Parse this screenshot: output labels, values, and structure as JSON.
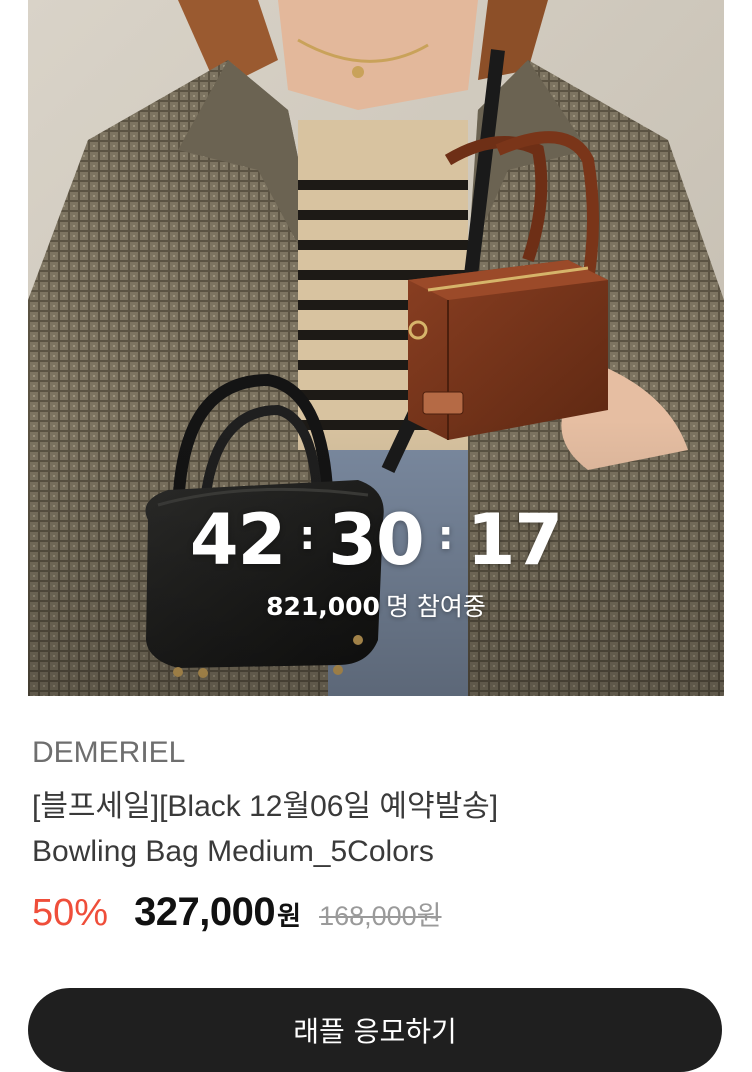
{
  "hero": {
    "countdown": {
      "hours": "42",
      "minutes": "30",
      "seconds": "17",
      "separator": ":"
    },
    "participants_count": "821,000",
    "participants_suffix": "명 참여중"
  },
  "product": {
    "brand": "DEMERIEL",
    "title_line1": "[블프세일][Black 12월06일 예약발송]",
    "title_line2": "Bowling Bag Medium_5Colors",
    "discount": "50%",
    "price": "327,000",
    "price_unit": "원",
    "original_price": "168,000원"
  },
  "cta": {
    "label": "래플 응모하기"
  },
  "colors": {
    "discount": "#ef4e3a",
    "cta_background": "#1f1f1f",
    "brand_text": "#6e6e6e"
  }
}
